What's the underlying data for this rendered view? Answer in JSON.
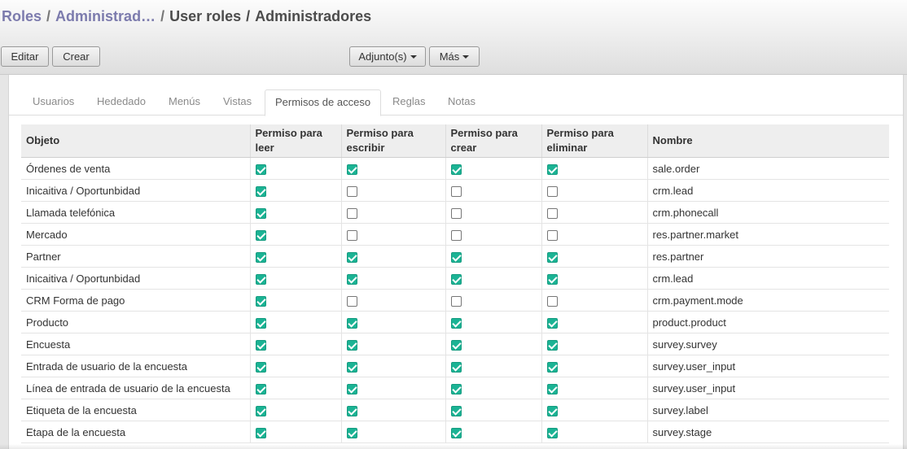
{
  "breadcrumb": {
    "items": [
      "Roles",
      "Administrad…",
      "User roles",
      "Administradores"
    ],
    "separator": "/"
  },
  "buttons": {
    "edit": "Editar",
    "create": "Crear",
    "attachments": "Adjunto(s)",
    "more": "Más"
  },
  "tabs": [
    "Usuarios",
    "Hededado",
    "Menús",
    "Vistas",
    "Permisos de acceso",
    "Reglas",
    "Notas"
  ],
  "active_tab": "Permisos de acceso",
  "table": {
    "headers": {
      "object": "Objeto",
      "read": "Permiso para leer",
      "write": "Permiso para escribir",
      "create": "Permiso para crear",
      "delete": "Permiso para eliminar",
      "name": "Nombre"
    },
    "rows": [
      {
        "object": "Órdenes de venta",
        "read": true,
        "write": true,
        "create": true,
        "delete": true,
        "name": "sale.order"
      },
      {
        "object": "Inicaitiva / Oportunbidad",
        "read": true,
        "write": false,
        "create": false,
        "delete": false,
        "name": "crm.lead"
      },
      {
        "object": "Llamada telefónica",
        "read": true,
        "write": false,
        "create": false,
        "delete": false,
        "name": "crm.phonecall"
      },
      {
        "object": "Mercado",
        "read": true,
        "write": false,
        "create": false,
        "delete": false,
        "name": "res.partner.market"
      },
      {
        "object": "Partner",
        "read": true,
        "write": true,
        "create": true,
        "delete": true,
        "name": "res.partner"
      },
      {
        "object": "Inicaitiva / Oportunbidad",
        "read": true,
        "write": true,
        "create": true,
        "delete": true,
        "name": "crm.lead"
      },
      {
        "object": "CRM Forma de pago",
        "read": true,
        "write": false,
        "create": false,
        "delete": false,
        "name": "crm.payment.mode"
      },
      {
        "object": "Producto",
        "read": true,
        "write": true,
        "create": true,
        "delete": true,
        "name": "product.product"
      },
      {
        "object": "Encuesta",
        "read": true,
        "write": true,
        "create": true,
        "delete": true,
        "name": "survey.survey"
      },
      {
        "object": "Entrada de usuario de la encuesta",
        "read": true,
        "write": true,
        "create": true,
        "delete": true,
        "name": "survey.user_input"
      },
      {
        "object": "Línea de entrada de usuario de la encuesta",
        "read": true,
        "write": true,
        "create": true,
        "delete": true,
        "name": "survey.user_input"
      },
      {
        "object": "Etiqueta de la encuesta",
        "read": true,
        "write": true,
        "create": true,
        "delete": true,
        "name": "survey.label"
      },
      {
        "object": "Etapa de la encuesta",
        "read": true,
        "write": true,
        "create": true,
        "delete": true,
        "name": "survey.stage"
      }
    ]
  },
  "colors": {
    "checkbox_checked": "#1bb394",
    "breadcrumb_link": "#7c7bad"
  }
}
